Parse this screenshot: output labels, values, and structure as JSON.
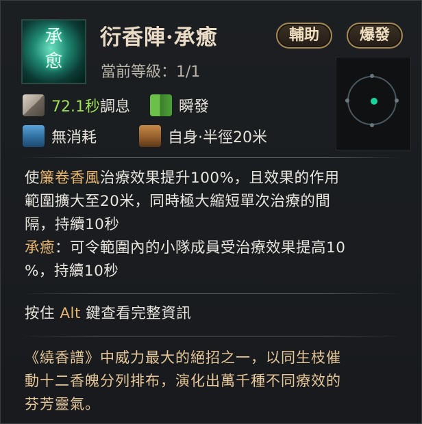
{
  "skill": {
    "icon_glyph_1": "承",
    "icon_glyph_2": "愈",
    "title": "衍香陣·承癒",
    "level_label": "當前等級：",
    "level_value": "1/1",
    "tags": [
      "輔助",
      "爆發"
    ]
  },
  "stats": {
    "cooldown_value": "72.1秒",
    "cooldown_label": "調息",
    "cast_label": "瞬發",
    "cost_label": "無消耗",
    "range_label": "自身·半徑20米"
  },
  "description": {
    "line1_pre": "使",
    "line1_hl": "簾卷香風",
    "line1_post": "治療效果提升100%，且效果的作用",
    "line2": "範圍擴大至20米，同時極大縮短單次治療的間",
    "line3": "隔，持續10秒",
    "line4_hl": "承癒",
    "line4_post": "：可令範圍內的小隊成員受治療效果提高10",
    "line5": "%，持續10秒"
  },
  "hint": {
    "pre": "按住 ",
    "key": "Alt",
    "post": " 鍵查看完整資訊"
  },
  "lore": {
    "line1": "《繞香譜》中威力最大的絕招之一，以同生枝催",
    "line2": "動十二香魄分列排布，演化出萬千種不同療效的",
    "line3": "芬芳靈氣。"
  },
  "colors": {
    "accent_green": "#9ddf5a",
    "highlight_orange": "#e9b872",
    "lore_gold": "#e6c89a"
  }
}
